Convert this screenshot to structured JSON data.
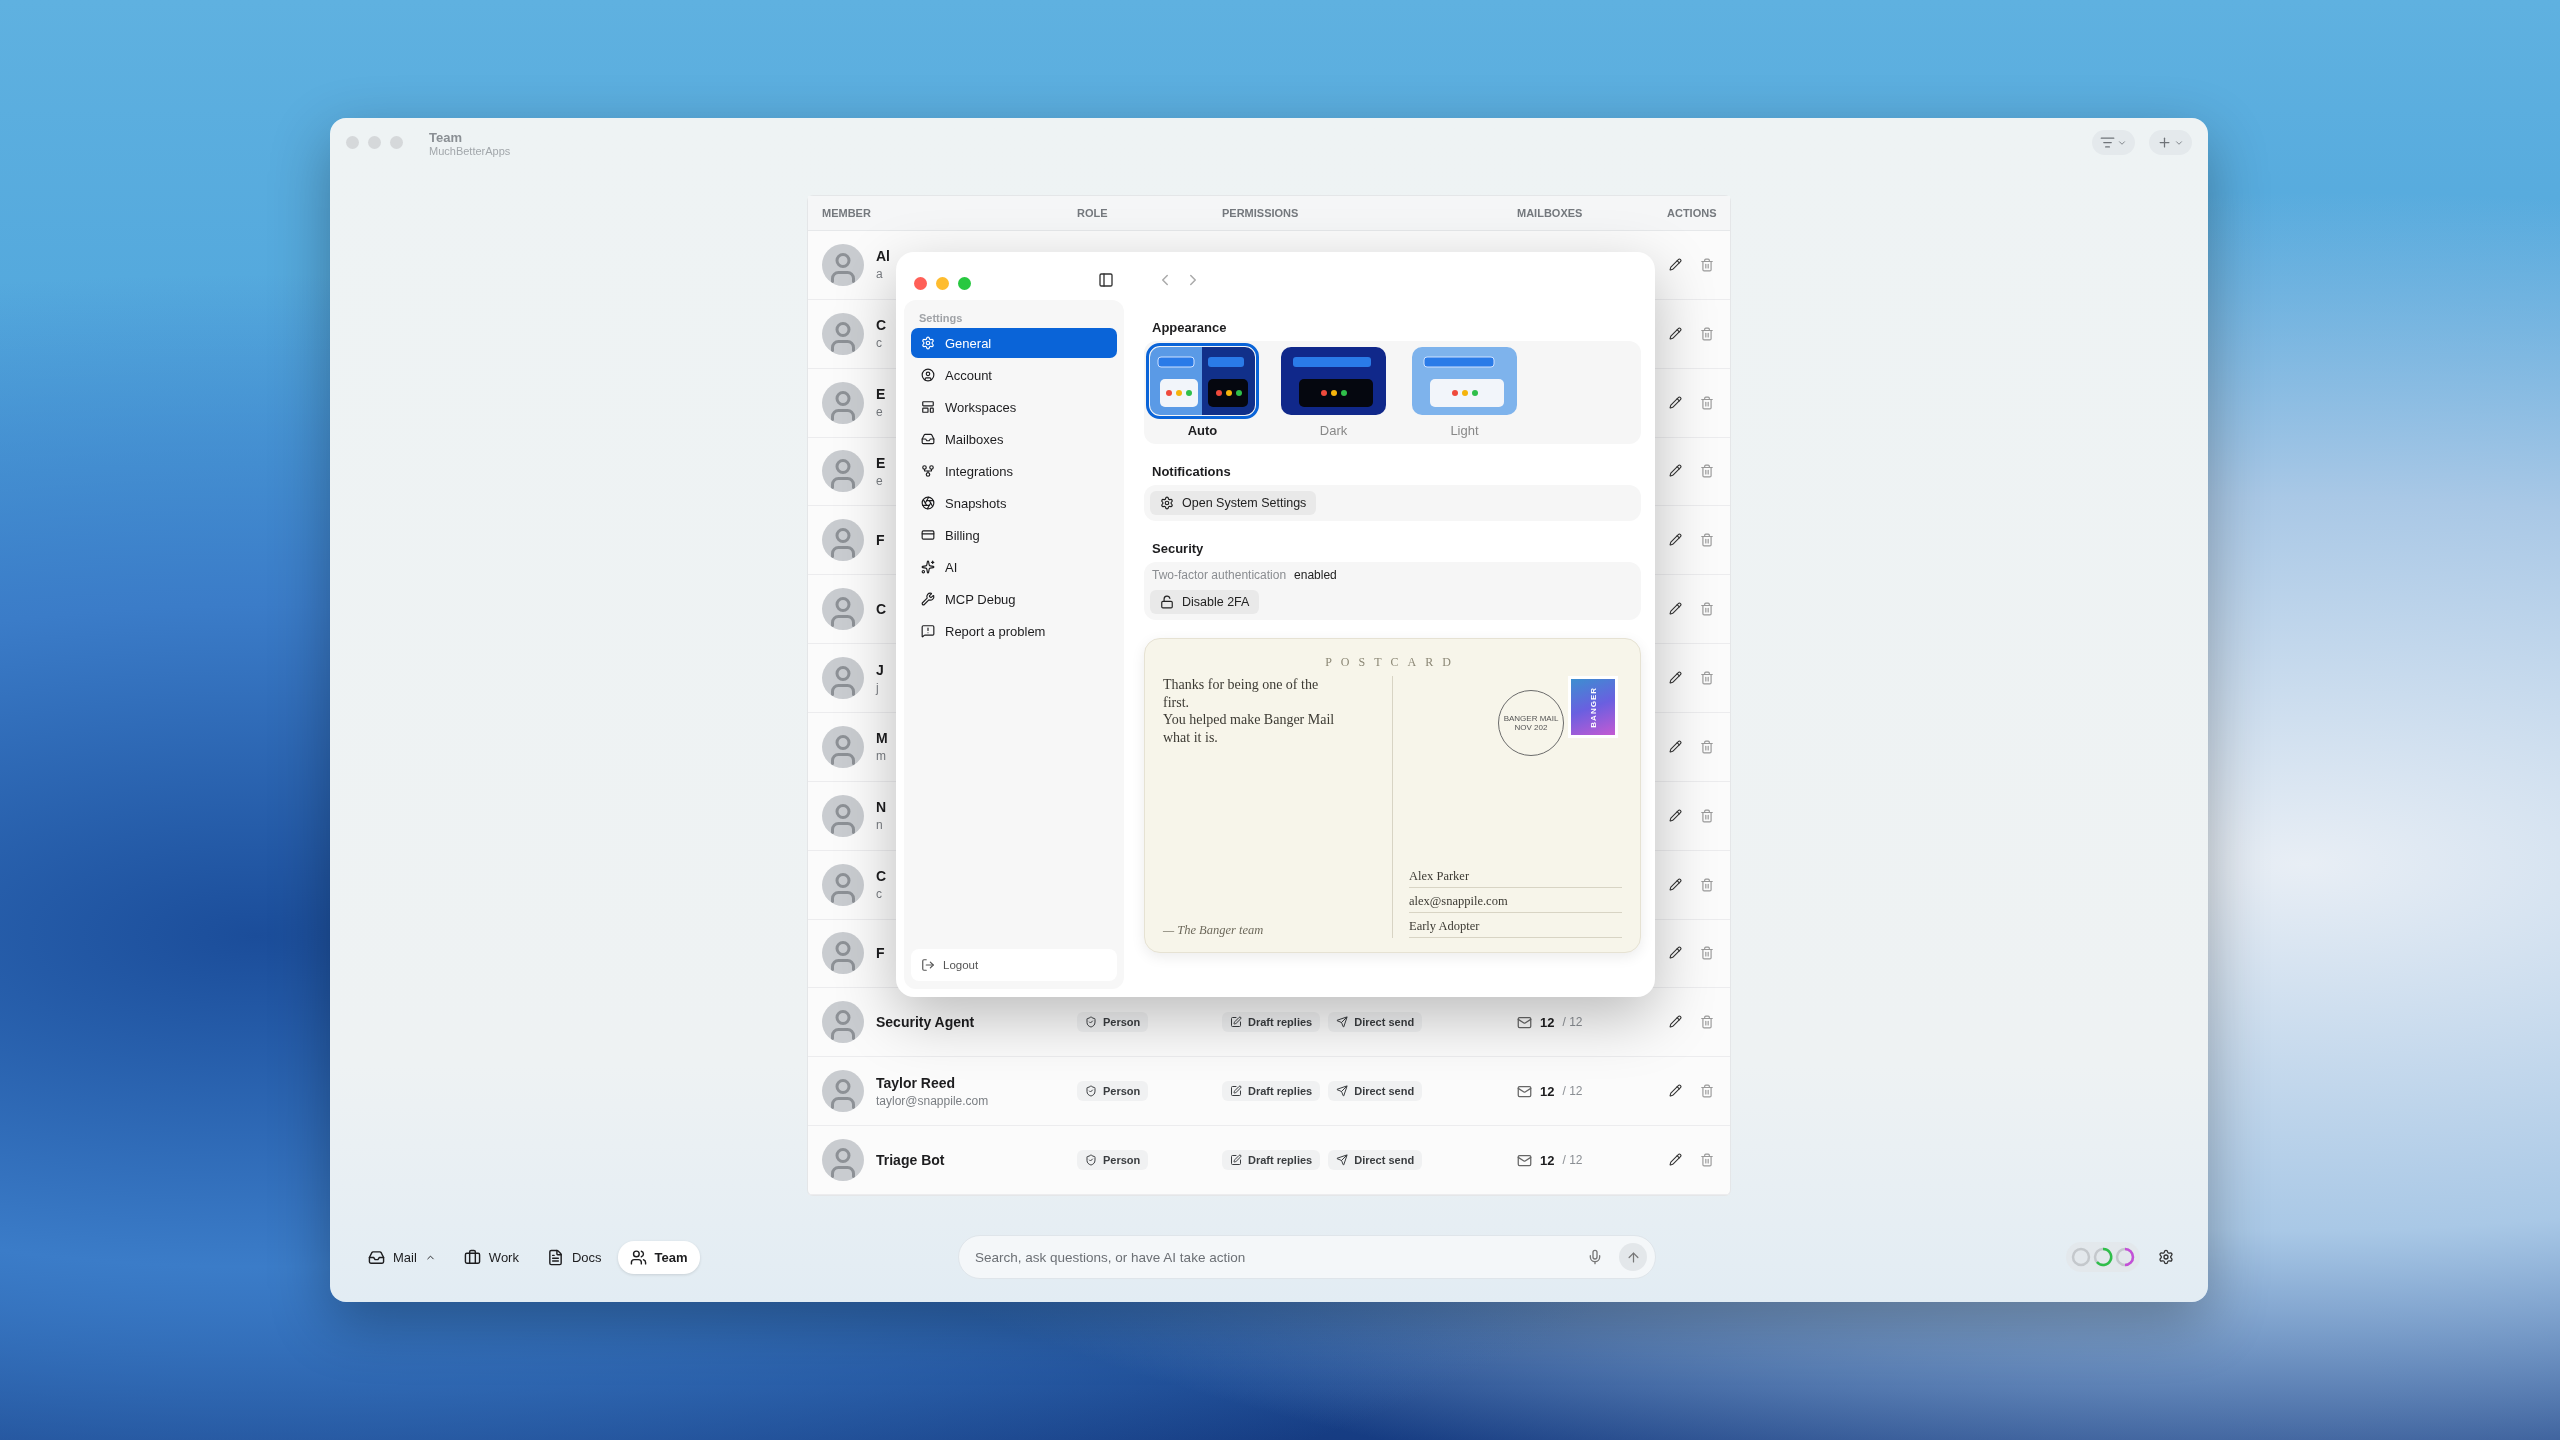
{
  "window": {
    "title": "Team",
    "subtitle": "MuchBetterApps"
  },
  "table": {
    "columns": [
      "MEMBER",
      "ROLE",
      "PERMISSIONS",
      "MAILBOXES",
      "ACTIONS"
    ],
    "rows": [
      {
        "name": "Al",
        "email": "a"
      },
      {
        "name": "C",
        "email": "c"
      },
      {
        "name": "E",
        "email": "e"
      },
      {
        "name": "E",
        "email": "e"
      },
      {
        "name": "F"
      },
      {
        "name": "C"
      },
      {
        "name": "J",
        "email": "j"
      },
      {
        "name": "M",
        "email": "m"
      },
      {
        "name": "N",
        "email": "n"
      },
      {
        "name": "C",
        "email": "c"
      },
      {
        "name": "F"
      },
      {
        "name": "Security Agent",
        "role": "Person",
        "permissions": [
          "Draft replies",
          "Direct send"
        ],
        "mailboxes": "12",
        "mailboxes_total": "/ 12"
      },
      {
        "name": "Taylor Reed",
        "email": "taylor@snappile.com",
        "role": "Person",
        "permissions": [
          "Draft replies",
          "Direct send"
        ],
        "mailboxes": "12",
        "mailboxes_total": "/ 12"
      },
      {
        "name": "Triage Bot",
        "role": "Person",
        "permissions": [
          "Draft replies",
          "Direct send"
        ],
        "mailboxes": "12",
        "mailboxes_total": "/ 12"
      }
    ]
  },
  "settings": {
    "sidebar_title": "Settings",
    "items": [
      {
        "label": "General",
        "selected": true
      },
      {
        "label": "Account",
        "selected": false
      },
      {
        "label": "Workspaces",
        "selected": false
      },
      {
        "label": "Mailboxes",
        "selected": false
      },
      {
        "label": "Integrations",
        "selected": false
      },
      {
        "label": "Snapshots",
        "selected": false
      },
      {
        "label": "Billing",
        "selected": false
      },
      {
        "label": "AI",
        "selected": false
      },
      {
        "label": "MCP Debug",
        "selected": false
      },
      {
        "label": "Report a problem",
        "selected": false
      }
    ],
    "logout": "Logout",
    "appearance": {
      "heading": "Appearance",
      "options": [
        {
          "label": "Auto",
          "kind": "auto",
          "selected": true
        },
        {
          "label": "Dark",
          "kind": "dark",
          "selected": false
        },
        {
          "label": "Light",
          "kind": "light",
          "selected": false
        }
      ]
    },
    "notifications": {
      "heading": "Notifications",
      "button": "Open System Settings"
    },
    "security": {
      "heading": "Security",
      "label": "Two-factor authentication",
      "status": "enabled",
      "button": "Disable 2FA"
    },
    "postcard": {
      "title": "POSTCARD",
      "message": [
        "Thanks for being one of the first.",
        "You helped make Banger Mail what it is."
      ],
      "signature": "— The Banger team",
      "stamp": "BANGER",
      "postmark": [
        "BANGER MAIL",
        "NOV 202"
      ],
      "address": [
        "Alex Parker",
        "alex@snappile.com",
        "Early Adopter"
      ]
    }
  },
  "bottom_bar": {
    "tabs": [
      {
        "label": "Mail",
        "selected": false
      },
      {
        "label": "Work",
        "selected": false
      },
      {
        "label": "Docs",
        "selected": false
      },
      {
        "label": "Team",
        "selected": true
      }
    ],
    "search": {
      "placeholder": "Search, ask questions, or have AI take action"
    }
  }
}
